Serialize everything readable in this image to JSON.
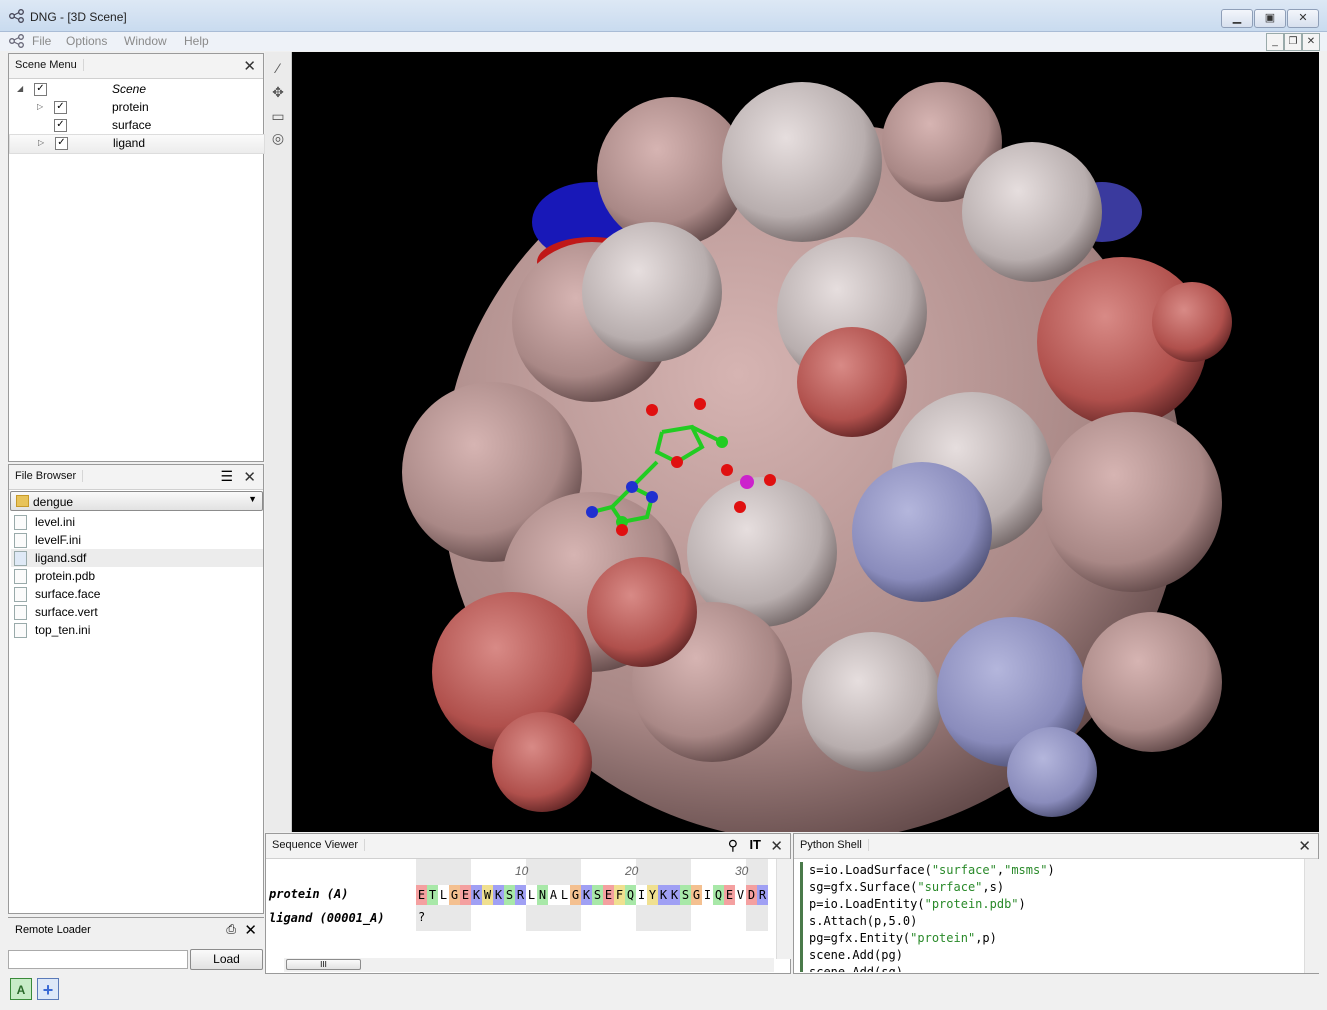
{
  "window": {
    "title": "DNG - [3D Scene]",
    "buttons": [
      "minimize",
      "maximize",
      "close"
    ]
  },
  "menu": {
    "items": [
      "File",
      "Options",
      "Window",
      "Help"
    ]
  },
  "scene_menu": {
    "title": "Scene Menu",
    "items": [
      {
        "label": "Scene",
        "checked": true,
        "expanded": true
      },
      {
        "label": "protein",
        "checked": true
      },
      {
        "label": "surface",
        "checked": true
      },
      {
        "label": "ligand",
        "checked": true,
        "selected": true
      }
    ]
  },
  "file_browser": {
    "title": "File Browser",
    "folder": "dengue",
    "files": [
      "level.ini",
      "levelF.ini",
      "ligand.sdf",
      "protein.pdb",
      "surface.face",
      "surface.vert",
      "top_ten.ini"
    ],
    "selected": "ligand.sdf"
  },
  "remote_loader": {
    "title": "Remote Loader",
    "input_value": "",
    "load_label": "Load"
  },
  "sequence_viewer": {
    "title": "Sequence Viewer",
    "ruler": [
      "10",
      "20",
      "30"
    ],
    "rows": [
      {
        "name": "protein (A)",
        "sequence": "ETLGEKWKSRLNALGKSEFQIYKKSGIQEVDR"
      },
      {
        "name": "ligand (00001_A)",
        "sequence": "?"
      }
    ]
  },
  "python_shell": {
    "title": "Python Shell",
    "lines": [
      "s=io.LoadSurface(\"surface\",\"msms\")",
      "sg=gfx.Surface(\"surface\",s)",
      "p=io.LoadEntity(\"protein.pdb\")",
      "s.Attach(p,5.0)",
      "pg=gfx.Entity(\"protein\",p)",
      "scene.Add(pg)",
      "scene.Add(sg)"
    ]
  },
  "statusbar": {
    "buttons": [
      "A",
      "+"
    ]
  },
  "colors": {
    "viewport_bg": "#000000",
    "accent": "#3a7bd5",
    "surface_red": "#b84a4a",
    "surface_white": "#c8c0c0",
    "surface_blue": "#8a8ec4"
  }
}
